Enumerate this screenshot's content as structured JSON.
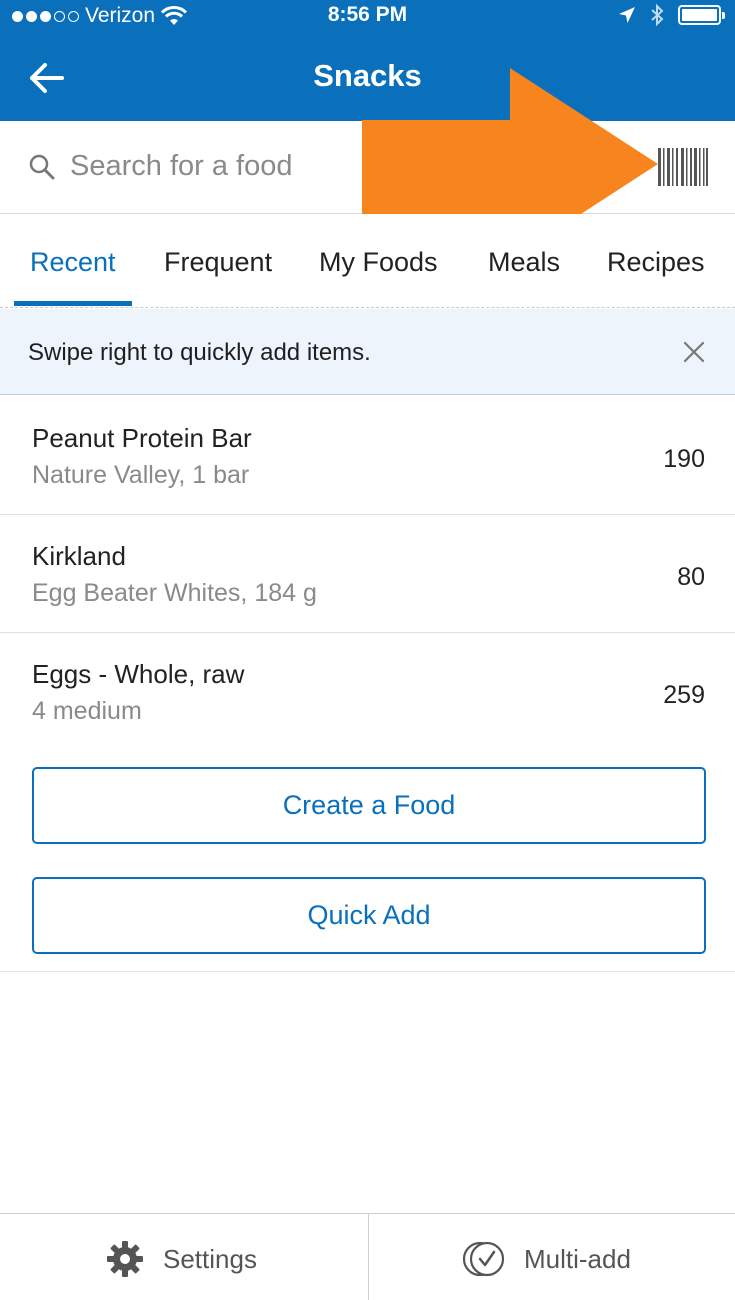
{
  "status_bar": {
    "carrier": "Verizon",
    "time": "8:56 PM",
    "signal_dots_filled": 3,
    "signal_dots_total": 5
  },
  "nav": {
    "title": "Snacks",
    "back_icon": "back-arrow-icon"
  },
  "search": {
    "placeholder": "Search for a food",
    "icon": "search-icon",
    "barcode_icon": "barcode-icon"
  },
  "overlay": {
    "arrow_color": "#f7841d"
  },
  "tabs": [
    {
      "label": "Recent",
      "active": true
    },
    {
      "label": "Frequent",
      "active": false
    },
    {
      "label": "My Foods",
      "active": false
    },
    {
      "label": "Meals",
      "active": false
    },
    {
      "label": "Recipes",
      "active": false
    }
  ],
  "tip": {
    "text": "Swipe right to quickly add items.",
    "close_icon": "close-icon"
  },
  "foods": [
    {
      "name": "Peanut Protein Bar",
      "desc": "Nature Valley, 1 bar",
      "calories": "190"
    },
    {
      "name": "Kirkland",
      "desc": "Egg Beater Whites, 184 g",
      "calories": "80"
    },
    {
      "name": "Eggs - Whole, raw",
      "desc": "4 medium",
      "calories": "259"
    }
  ],
  "buttons": {
    "create_food": "Create a Food",
    "quick_add": "Quick Add"
  },
  "toolbar": {
    "settings_label": "Settings",
    "settings_icon": "gear-icon",
    "multi_add_label": "Multi-add",
    "multi_add_icon": "multi-check-icon"
  },
  "colors": {
    "brand_blue": "#0a70bb",
    "tip_background": "#eef4fb"
  }
}
